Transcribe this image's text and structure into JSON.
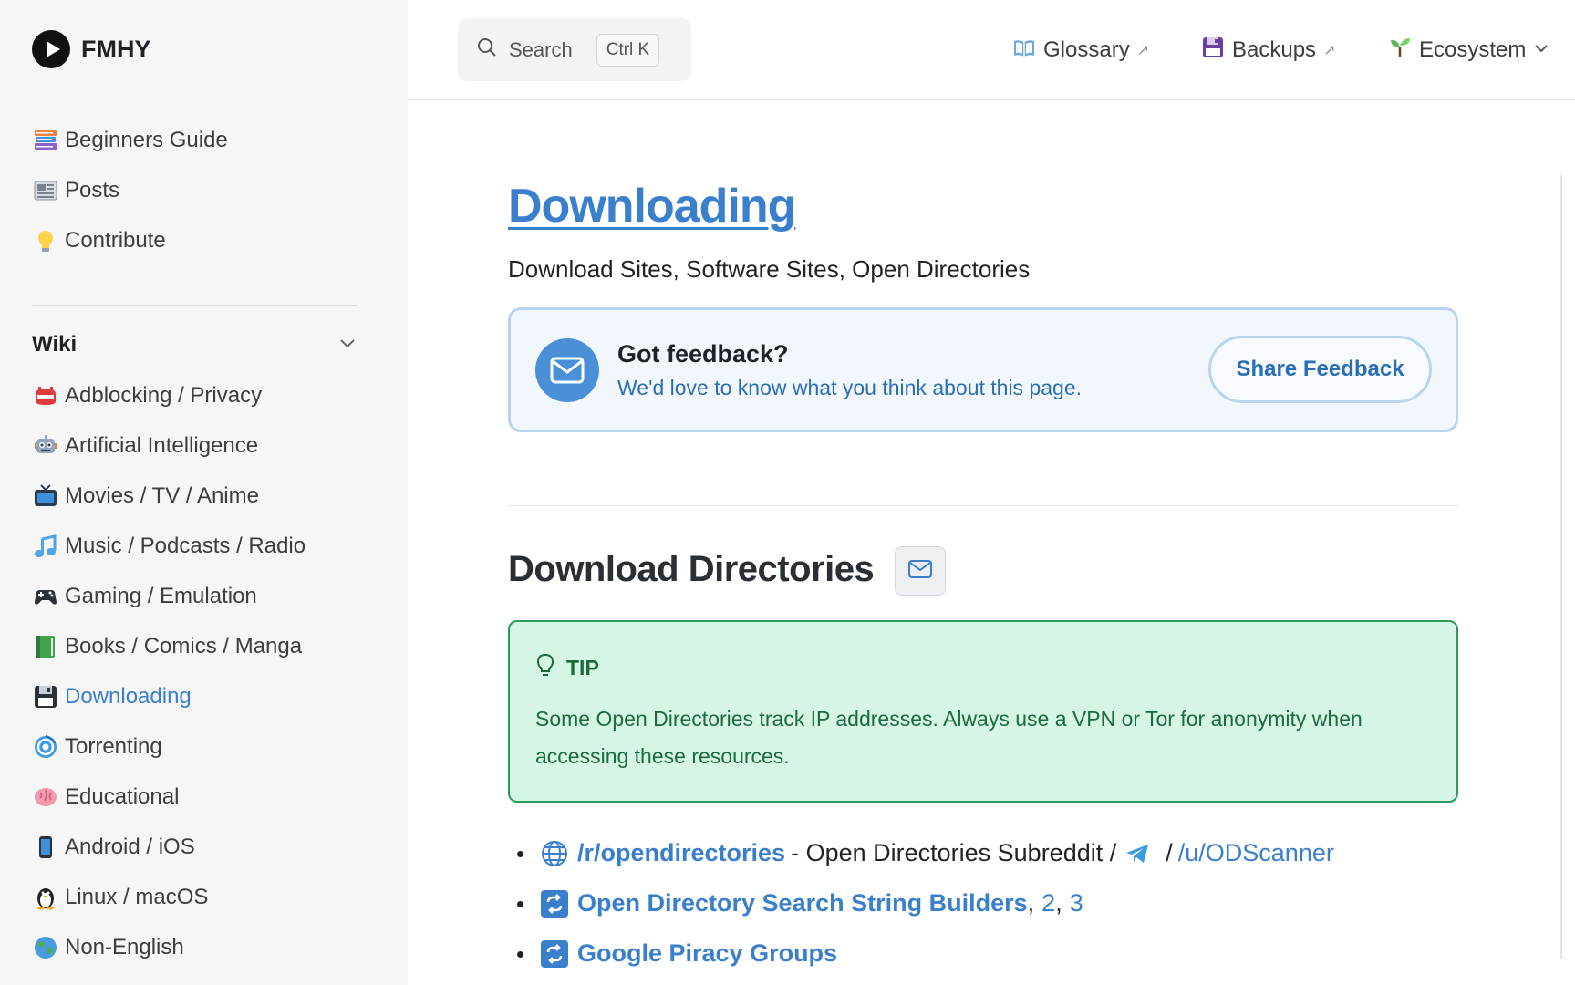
{
  "app": {
    "name": "FMHY"
  },
  "top_nav": {
    "search_placeholder": "Search",
    "search_shortcut": "Ctrl K",
    "links": [
      {
        "label": "Glossary",
        "arrow": "↗",
        "icon": "book-icon"
      },
      {
        "label": "Backups",
        "arrow": "↗",
        "icon": "floppy-disk-icon"
      },
      {
        "label": "Ecosystem",
        "icon": "seedling-icon"
      }
    ]
  },
  "sidebar": {
    "top_items": [
      {
        "label": "Beginners Guide",
        "icon": "books-icon"
      },
      {
        "label": "Posts",
        "icon": "newspaper-icon"
      },
      {
        "label": "Contribute",
        "icon": "lightbulb-icon"
      }
    ],
    "wiki_label": "Wiki",
    "wiki_items": [
      {
        "label": "Adblocking / Privacy",
        "icon": "stop-sign-icon"
      },
      {
        "label": "Artificial Intelligence",
        "icon": "robot-icon"
      },
      {
        "label": "Movies / TV / Anime",
        "icon": "tv-icon"
      },
      {
        "label": "Music / Podcasts / Radio",
        "icon": "music-note-icon"
      },
      {
        "label": "Gaming / Emulation",
        "icon": "gamepad-icon"
      },
      {
        "label": "Books / Comics / Manga",
        "icon": "green-book-icon"
      },
      {
        "label": "Downloading",
        "icon": "floppy-disk-icon",
        "active": true
      },
      {
        "label": "Torrenting",
        "icon": "cyclone-icon"
      },
      {
        "label": "Educational",
        "icon": "brain-icon"
      },
      {
        "label": "Android / iOS",
        "icon": "phone-icon"
      },
      {
        "label": "Linux / macOS",
        "icon": "penguin-icon"
      },
      {
        "label": "Non-English",
        "icon": "globe-icon"
      }
    ]
  },
  "page": {
    "title": "Downloading",
    "subtitle": "Download Sites, Software Sites, Open Directories",
    "feedback": {
      "heading": "Got feedback?",
      "text": "We'd love to know what you think about this page.",
      "button": "Share Feedback"
    },
    "section_title": "Download Directories",
    "tip": {
      "label": "TIP",
      "text": "Some Open Directories track IP addresses. Always use a VPN or Tor for anonymity when accessing these resources."
    },
    "links": {
      "item1": {
        "link": "/r/opendirectories",
        "text": "- Open Directories Subreddit /",
        "sep": "/",
        "link2": "/u/ODScanner"
      },
      "item2": {
        "link": "Open Directory Search String Builders",
        "comma1": ",",
        "n2": "2",
        "comma2": ",",
        "n3": "3"
      },
      "item3": {
        "link": "Google Piracy Groups"
      }
    }
  },
  "colors": {
    "accent": "#3a7fcc",
    "tip_bg": "#d5f6e4",
    "tip_border": "#2e9a5b",
    "feedback_bg": "#f2f7fd"
  }
}
